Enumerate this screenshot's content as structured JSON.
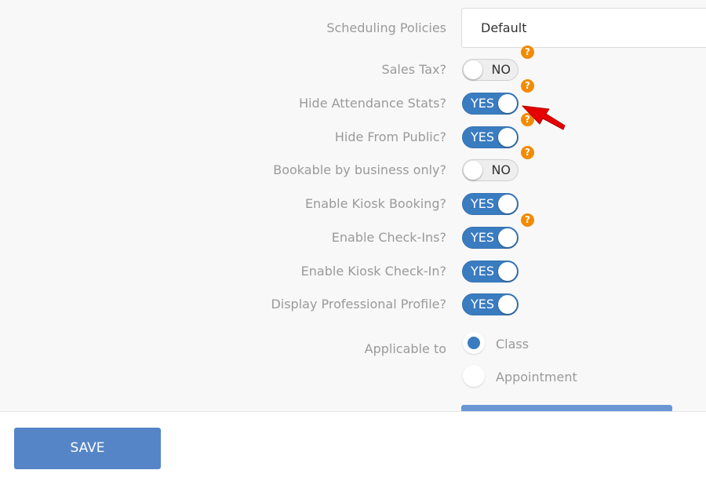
{
  "scheduling": {
    "label": "Scheduling Policies",
    "value": "Default"
  },
  "settings": [
    {
      "label": "Sales Tax?",
      "state": "NO",
      "help": true
    },
    {
      "label": "Hide Attendance Stats?",
      "state": "YES",
      "help": true
    },
    {
      "label": "Hide From Public?",
      "state": "YES",
      "help": true
    },
    {
      "label": "Bookable by business only?",
      "state": "NO",
      "help": true
    },
    {
      "label": "Enable Kiosk Booking?",
      "state": "YES",
      "help": false
    },
    {
      "label": "Enable Check-Ins?",
      "state": "YES",
      "help": true
    },
    {
      "label": "Enable Kiosk Check-In?",
      "state": "YES",
      "help": false
    },
    {
      "label": "Display Professional Profile?",
      "state": "YES",
      "help": false
    }
  ],
  "applicable": {
    "label": "Applicable to",
    "options": [
      {
        "label": "Class",
        "selected": true
      },
      {
        "label": "Appointment",
        "selected": false
      }
    ]
  },
  "help_icon": {
    "symbol": "?",
    "icon": "question-icon",
    "color": "#f28b00"
  },
  "footer": {
    "save_label": "SAVE"
  },
  "colors": {
    "toggle_on": "#3a7cc0",
    "save_button": "#5585c6",
    "annotation_arrow": "#e60000"
  }
}
